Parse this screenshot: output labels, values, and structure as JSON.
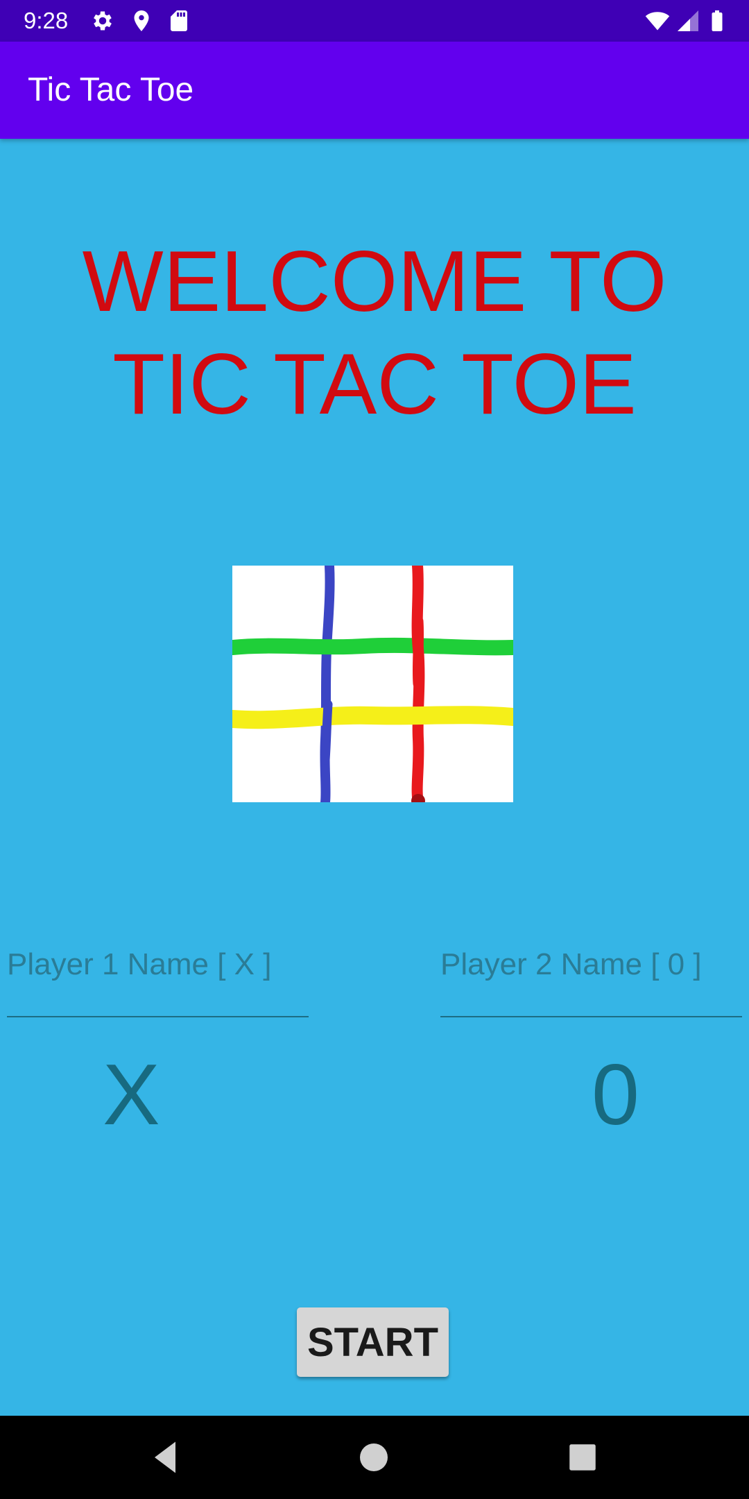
{
  "status_bar": {
    "time": "9:28",
    "left_icons": [
      "settings-icon",
      "location-icon",
      "sd-card-icon"
    ],
    "right_icons": [
      "wifi-icon",
      "signal-icon",
      "battery-icon"
    ]
  },
  "app_bar": {
    "title": "Tic Tac Toe"
  },
  "welcome": {
    "line1": "WELCOME TO",
    "line2": "TIC TAC TOE"
  },
  "board_image": {
    "icon": "tic-tac-toe-grid",
    "line_colors": [
      "#3b45c4",
      "#e8191d",
      "#1fcf39",
      "#f5ef19"
    ]
  },
  "players": {
    "player1": {
      "placeholder": "Player 1 Name [ X ]",
      "value": "",
      "symbol": "X"
    },
    "player2": {
      "placeholder": "Player 2 Name [ 0 ]",
      "value": "",
      "symbol": "0"
    }
  },
  "start_button": {
    "label": "START"
  },
  "nav_bar": {
    "icons": [
      "back-icon",
      "home-icon",
      "recents-icon"
    ]
  },
  "colors": {
    "background": "#35b5e6",
    "app_bar": "#6200ee",
    "status_bar": "#3f00b5",
    "welcome_text": "#d10a10",
    "symbol_text": "#176a80"
  }
}
